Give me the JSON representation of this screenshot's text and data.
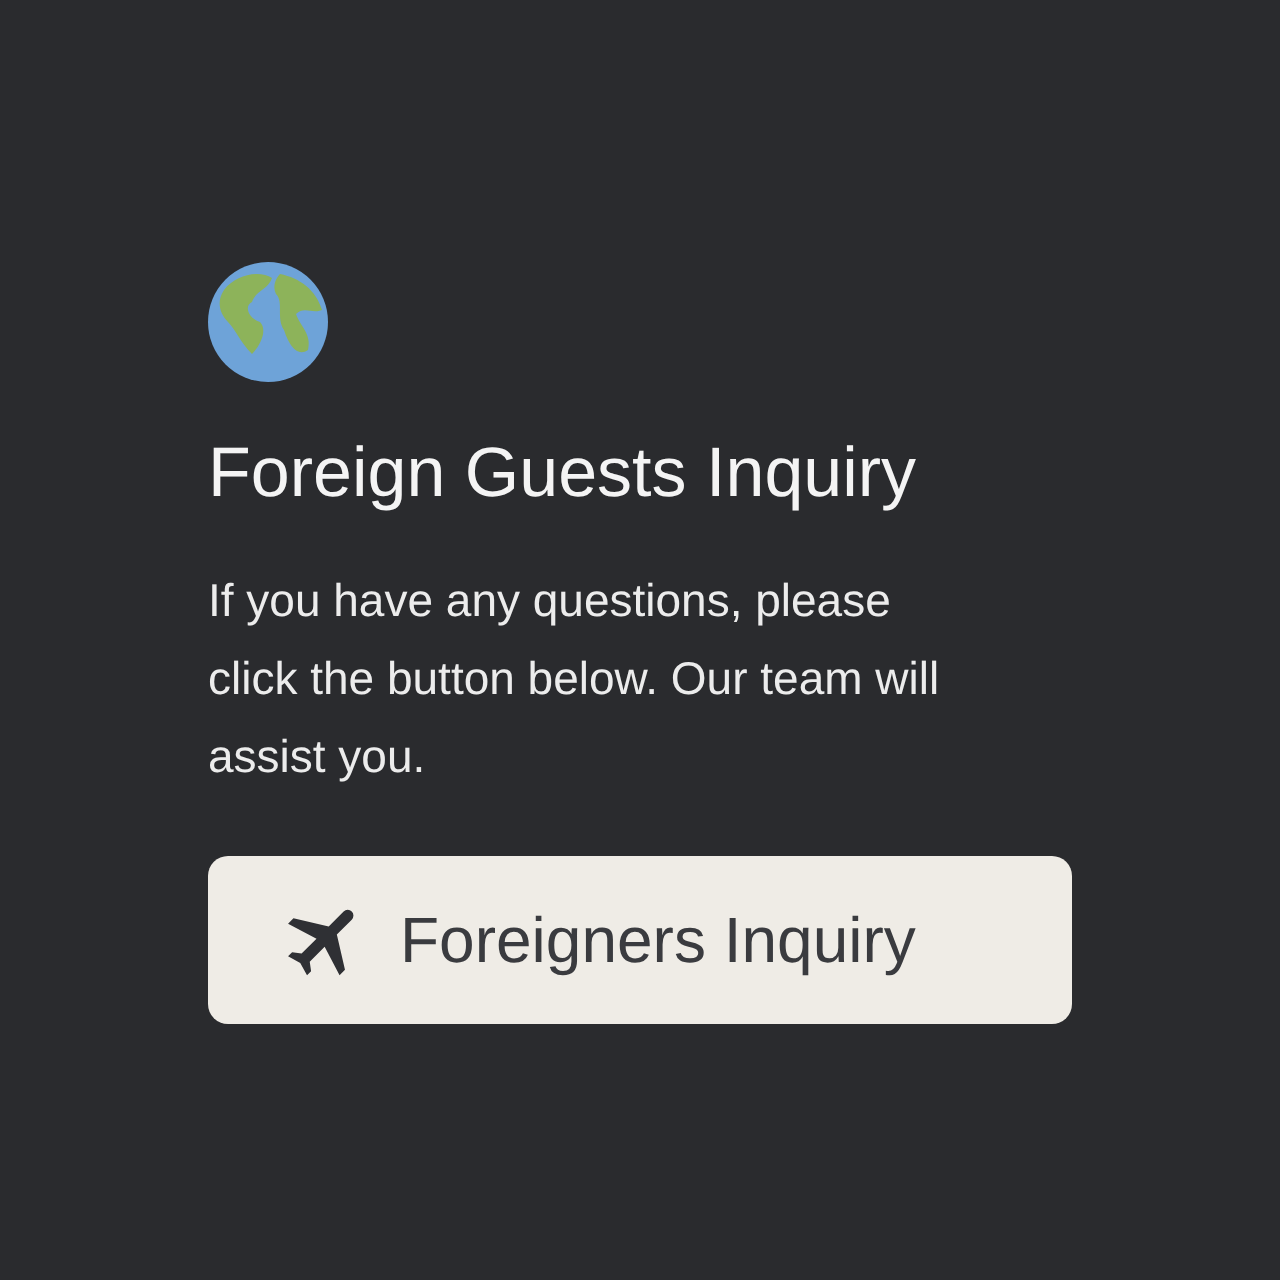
{
  "title": "Foreign Guests Inquiry",
  "description": "If you have any questions, please click the button below. Our team will assist you.",
  "button": {
    "label": "Foreigners Inquiry"
  }
}
